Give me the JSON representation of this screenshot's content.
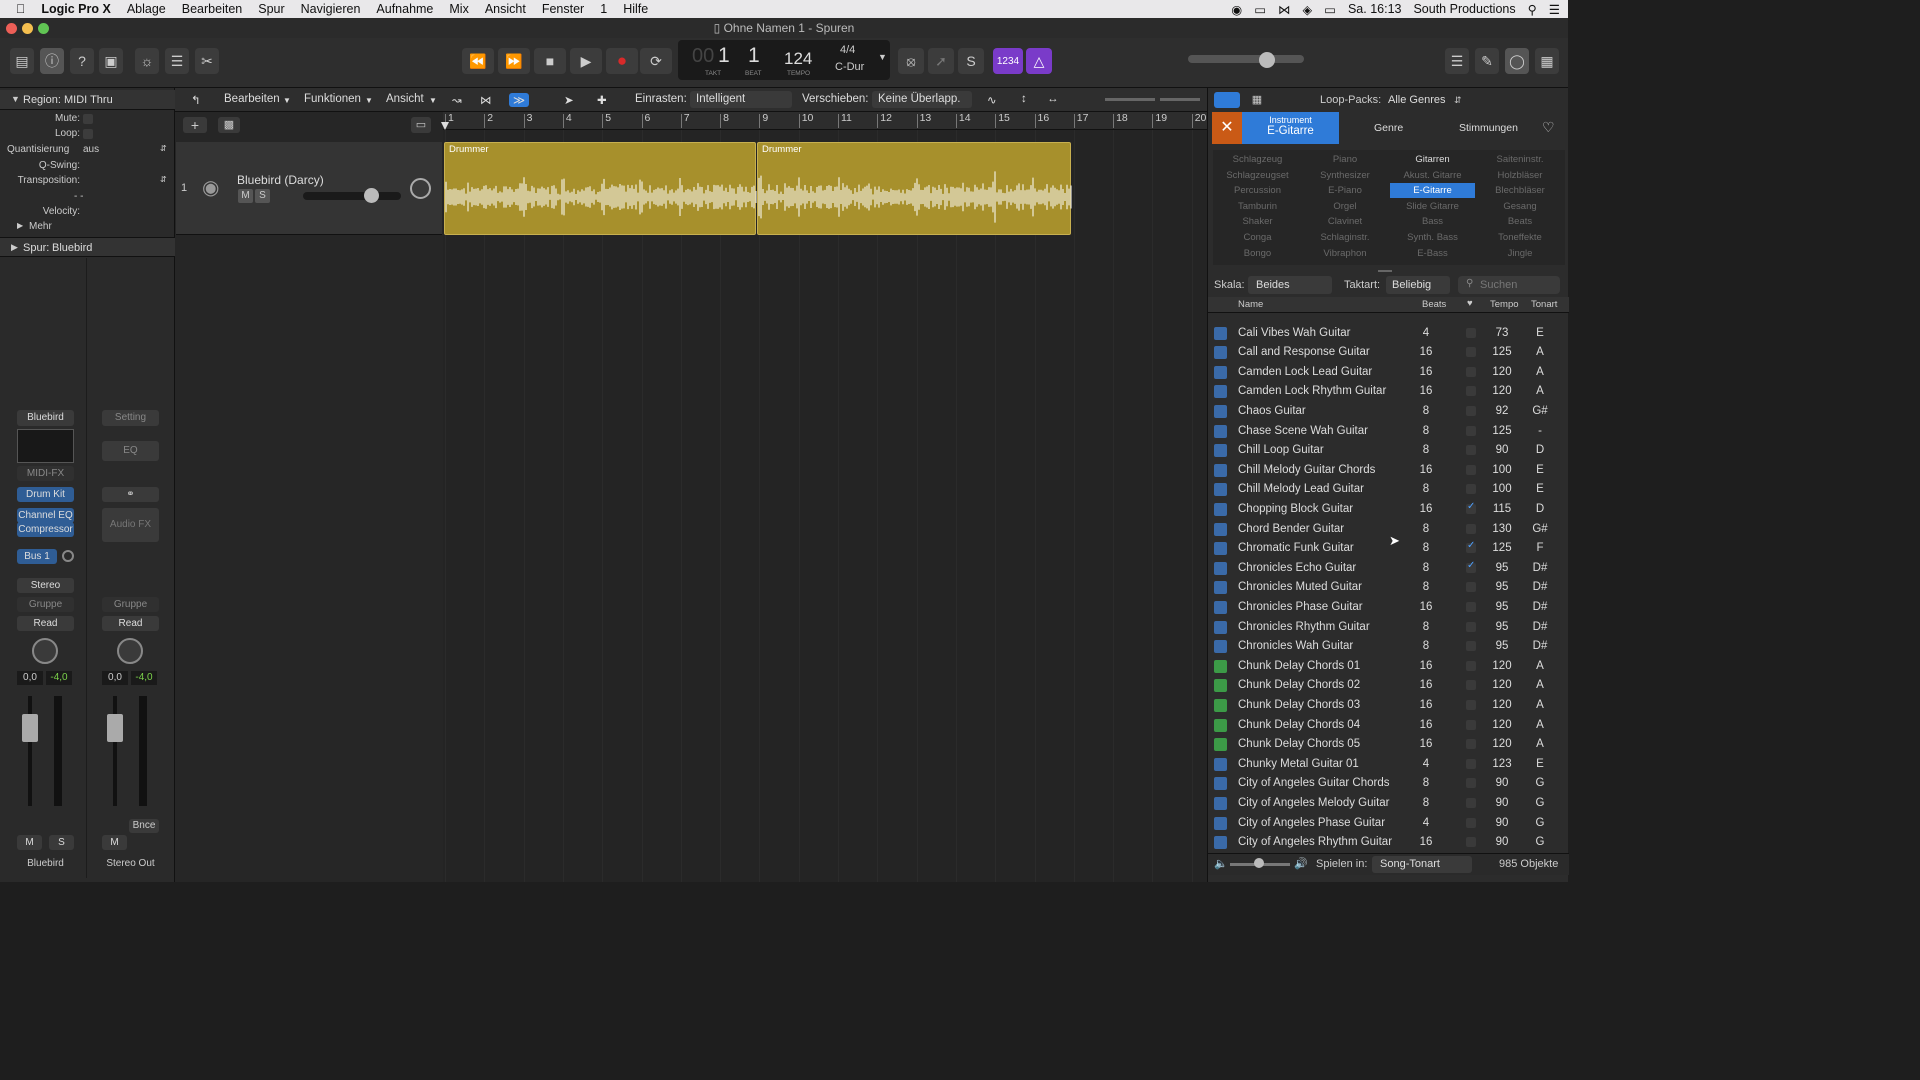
{
  "menubar": {
    "app": "Logic Pro X",
    "items": [
      "Ablage",
      "Bearbeiten",
      "Spur",
      "Navigieren",
      "Aufnahme",
      "Mix",
      "Ansicht",
      "Fenster",
      "1",
      "Hilfe"
    ],
    "clock": "Sa. 16:13",
    "user": "South Productions"
  },
  "window": {
    "title": "Ohne Namen 1 - Spuren"
  },
  "lcd": {
    "bar": "1",
    "beat": "1",
    "bar_prefix": "00",
    "bar_label": "TAKT",
    "beat_label": "BEAT",
    "tempo": "124",
    "tempo_label": "TEMPO",
    "signature": "4/4",
    "key": "C-Dur"
  },
  "toolbar": {
    "count_in": "1234"
  },
  "inspector": {
    "region_title": "Region:",
    "region_name": "MIDI Thru",
    "mute": "Mute:",
    "loop": "Loop:",
    "quant": "Quantisierung",
    "quant_val": "aus",
    "qswing": "Q-Swing:",
    "transposition": "Transposition:",
    "velocity": "Velocity:",
    "more": "Mehr",
    "dashes": "- -",
    "track_title": "Spur:",
    "track_name": "Bluebird",
    "strip1": {
      "name": "Bluebird",
      "midifx": "MIDI-FX",
      "inst": "Drum Kit",
      "fx1": "Channel EQ",
      "fx2": "Compressor",
      "send": "Bus 1",
      "out": "Stereo",
      "group": "Gruppe",
      "auto": "Read",
      "vol": "0,0",
      "peak": "-4,0",
      "m": "M",
      "s": "S",
      "label": "Bluebird"
    },
    "strip2": {
      "setting": "Setting",
      "eq": "EQ",
      "audiofx": "Audio FX",
      "group": "Gruppe",
      "auto": "Read",
      "vol": "0,0",
      "peak": "-4,0",
      "m": "M",
      "bnce": "Bnce",
      "label": "Stereo Out"
    }
  },
  "tracks_toolbar": {
    "edit": "Bearbeiten",
    "functions": "Funktionen",
    "view": "Ansicht",
    "snap_label": "Einrasten:",
    "snap_val": "Intelligent",
    "drag_label": "Verschieben:",
    "drag_val": "Keine Überlapp."
  },
  "track": {
    "number": "1",
    "name": "Bluebird (Darcy)",
    "m": "M",
    "s": "S"
  },
  "ruler": [
    "1",
    "2",
    "3",
    "4",
    "5",
    "6",
    "7",
    "8",
    "9",
    "10",
    "11",
    "12",
    "13",
    "14",
    "15",
    "16",
    "17",
    "18",
    "19",
    "20"
  ],
  "regions": [
    {
      "label": "Drummer"
    },
    {
      "label": "Drummer"
    }
  ],
  "loops": {
    "packs_label": "Loop-Packs:",
    "packs_val": "Alle Genres",
    "tabs": {
      "instrument_top": "Instrument",
      "instrument_sel": "E-Gitarre",
      "genre": "Genre",
      "moods": "Stimmungen"
    },
    "grid": [
      [
        "Schlagzeug",
        "Piano",
        "Gitarren",
        "Saiteninstr."
      ],
      [
        "Schlagzeugset",
        "Synthesizer",
        "Akust. Gitarre",
        "Holzbläser"
      ],
      [
        "Percussion",
        "E-Piano",
        "E-Gitarre",
        "Blechbläser"
      ],
      [
        "Tamburin",
        "Orgel",
        "Slide Gitarre",
        "Gesang"
      ],
      [
        "Shaker",
        "Clavinet",
        "Bass",
        "Beats"
      ],
      [
        "Conga",
        "Schlaginstr.",
        "Synth. Bass",
        "Toneffekte"
      ],
      [
        "Bongo",
        "Vibraphon",
        "E-Bass",
        "Jingle"
      ]
    ],
    "scale_label": "Skala:",
    "scale_val": "Beides",
    "sig_label": "Taktart:",
    "sig_val": "Beliebig",
    "search_placeholder": "Suchen",
    "cols": {
      "name": "Name",
      "beats": "Beats",
      "tempo": "Tempo",
      "key": "Tonart"
    },
    "rows": [
      {
        "n": "Cali Vibes Wah Guitar",
        "b": "4",
        "f": false,
        "t": "73",
        "k": "E",
        "g": false
      },
      {
        "n": "Call and Response Guitar",
        "b": "16",
        "f": false,
        "t": "125",
        "k": "A",
        "g": false
      },
      {
        "n": "Camden Lock Lead Guitar",
        "b": "16",
        "f": false,
        "t": "120",
        "k": "A",
        "g": false
      },
      {
        "n": "Camden Lock Rhythm Guitar",
        "b": "16",
        "f": false,
        "t": "120",
        "k": "A",
        "g": false
      },
      {
        "n": "Chaos Guitar",
        "b": "8",
        "f": false,
        "t": "92",
        "k": "G#",
        "g": false
      },
      {
        "n": "Chase Scene Wah Guitar",
        "b": "8",
        "f": false,
        "t": "125",
        "k": "-",
        "g": false
      },
      {
        "n": "Chill Loop Guitar",
        "b": "8",
        "f": false,
        "t": "90",
        "k": "D",
        "g": false
      },
      {
        "n": "Chill Melody Guitar Chords",
        "b": "16",
        "f": false,
        "t": "100",
        "k": "E",
        "g": false
      },
      {
        "n": "Chill Melody Lead Guitar",
        "b": "8",
        "f": false,
        "t": "100",
        "k": "E",
        "g": false
      },
      {
        "n": "Chopping Block Guitar",
        "b": "16",
        "f": true,
        "t": "115",
        "k": "D",
        "g": false
      },
      {
        "n": "Chord Bender Guitar",
        "b": "8",
        "f": false,
        "t": "130",
        "k": "G#",
        "g": false
      },
      {
        "n": "Chromatic Funk Guitar",
        "b": "8",
        "f": true,
        "t": "125",
        "k": "F",
        "g": false
      },
      {
        "n": "Chronicles Echo Guitar",
        "b": "8",
        "f": true,
        "t": "95",
        "k": "D#",
        "g": false
      },
      {
        "n": "Chronicles Muted Guitar",
        "b": "8",
        "f": false,
        "t": "95",
        "k": "D#",
        "g": false
      },
      {
        "n": "Chronicles Phase Guitar",
        "b": "16",
        "f": false,
        "t": "95",
        "k": "D#",
        "g": false
      },
      {
        "n": "Chronicles Rhythm Guitar",
        "b": "8",
        "f": false,
        "t": "95",
        "k": "D#",
        "g": false
      },
      {
        "n": "Chronicles Wah Guitar",
        "b": "8",
        "f": false,
        "t": "95",
        "k": "D#",
        "g": false
      },
      {
        "n": "Chunk Delay Chords 01",
        "b": "16",
        "f": false,
        "t": "120",
        "k": "A",
        "g": true
      },
      {
        "n": "Chunk Delay Chords 02",
        "b": "16",
        "f": false,
        "t": "120",
        "k": "A",
        "g": true
      },
      {
        "n": "Chunk Delay Chords 03",
        "b": "16",
        "f": false,
        "t": "120",
        "k": "A",
        "g": true
      },
      {
        "n": "Chunk Delay Chords 04",
        "b": "16",
        "f": false,
        "t": "120",
        "k": "A",
        "g": true
      },
      {
        "n": "Chunk Delay Chords 05",
        "b": "16",
        "f": false,
        "t": "120",
        "k": "A",
        "g": true
      },
      {
        "n": "Chunky Metal Guitar 01",
        "b": "4",
        "f": false,
        "t": "123",
        "k": "E",
        "g": false
      },
      {
        "n": "City of Angeles Guitar Chords",
        "b": "8",
        "f": false,
        "t": "90",
        "k": "G",
        "g": false
      },
      {
        "n": "City of Angeles Melody Guitar",
        "b": "8",
        "f": false,
        "t": "90",
        "k": "G",
        "g": false
      },
      {
        "n": "City of Angeles Phase Guitar",
        "b": "4",
        "f": false,
        "t": "90",
        "k": "G",
        "g": false
      },
      {
        "n": "City of Angeles Rhythm Guitar",
        "b": "16",
        "f": false,
        "t": "90",
        "k": "G",
        "g": false
      }
    ],
    "play_in_label": "Spielen in:",
    "play_in_val": "Song-Tonart",
    "count": "985 Objekte"
  },
  "colors": {
    "accent": "#2f7bd8",
    "region": "#a7902c",
    "record": "#d82a2a",
    "purple": "#7a3bc9"
  }
}
